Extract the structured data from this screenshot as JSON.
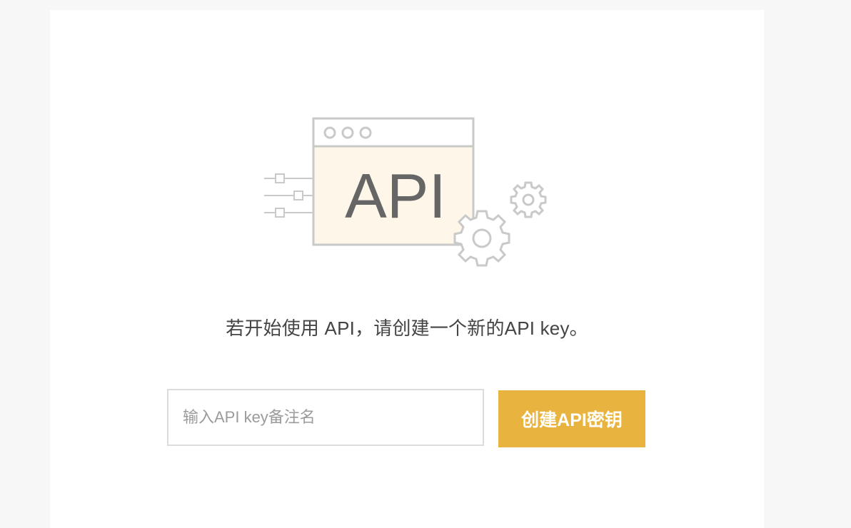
{
  "hero": {
    "illustration_text": "API",
    "icon": "api-window-gears-illustration"
  },
  "message": "若开始使用 API，请创建一个新的API key。",
  "form": {
    "note_input_placeholder": "输入API key备注名",
    "note_input_value": "",
    "create_button_label": "创建API密钥"
  },
  "colors": {
    "accent": "#e8b33e",
    "illustration_stroke": "#c9c9c9",
    "illustration_fill": "#fdf6e9",
    "text": "#444444",
    "page_bg": "#f7f7f7"
  }
}
